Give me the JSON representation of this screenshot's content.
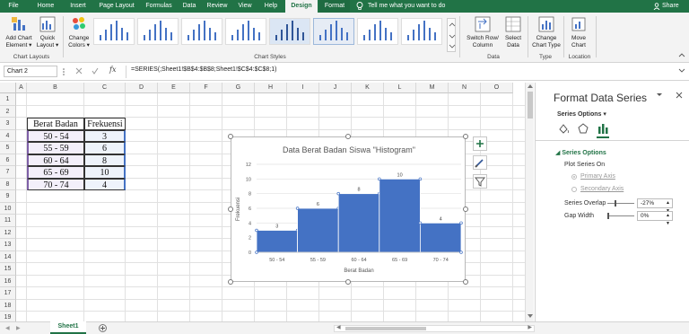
{
  "tabs": [
    "File",
    "Home",
    "Insert",
    "Page Layout",
    "Formulas",
    "Data",
    "Review",
    "View",
    "Help",
    "Design",
    "Format"
  ],
  "tell_me": "Tell me what you want to do",
  "share": "Share",
  "ribbon": {
    "add_chart_element": [
      "Add Chart",
      "Element ▾"
    ],
    "quick_layout": [
      "Quick",
      "Layout ▾"
    ],
    "change_colors": [
      "Change",
      "Colors ▾"
    ],
    "switch_row_column": [
      "Switch Row/",
      "Column"
    ],
    "select_data": [
      "Select",
      "Data"
    ],
    "change_chart_type": [
      "Change",
      "Chart Type"
    ],
    "move_chart": [
      "Move",
      "Chart"
    ],
    "groups": {
      "chart_layouts": "Chart Layouts",
      "chart_styles": "Chart Styles",
      "data": "Data",
      "type": "Type",
      "location": "Location"
    }
  },
  "formula_bar": {
    "name_box": "Chart 2",
    "fx": "fx",
    "formula": "=SERIES(;Sheet1!$B$4:$B$8;Sheet1!$C$4:$C$8;1)"
  },
  "columns": [
    "A",
    "B",
    "C",
    "D",
    "E",
    "F",
    "G",
    "H",
    "I",
    "J",
    "K",
    "L",
    "M",
    "N",
    "O"
  ],
  "rows": [
    "1",
    "2",
    "3",
    "4",
    "5",
    "6",
    "7",
    "8",
    "9",
    "10",
    "11",
    "12",
    "13",
    "14",
    "15",
    "16",
    "17",
    "18",
    "19"
  ],
  "table": {
    "header": [
      "Berat Badan",
      "Frekuensi"
    ],
    "rows": [
      [
        "50 - 54",
        "3"
      ],
      [
        "55 - 59",
        "6"
      ],
      [
        "60 - 64",
        "8"
      ],
      [
        "65 - 69",
        "10"
      ],
      [
        "70 - 74",
        "4"
      ]
    ]
  },
  "chart_data": {
    "type": "bar",
    "title": "Data Berat Badan Siswa \"Histogram\"",
    "xlabel": "Berat Badan",
    "ylabel": "Frekuensi",
    "categories": [
      "50 - 54",
      "55 - 59",
      "60 - 64",
      "65 - 69",
      "70 - 74"
    ],
    "values": [
      3,
      6,
      8,
      10,
      4
    ],
    "ylim": [
      0,
      12
    ],
    "yticks": [
      "0",
      "2",
      "4",
      "6",
      "8",
      "10",
      "12"
    ],
    "gap_width_pct": 0,
    "bar_color": "#4472c4",
    "grid": true
  },
  "panel": {
    "title": "Format Data Series",
    "series_options_menu": "Series Options",
    "section": "Series Options",
    "plot_series_on": "Plot Series On",
    "primary_axis": "Primary Axis",
    "secondary_axis": "Secondary Axis",
    "series_overlap_label": "Series Overlap",
    "series_overlap_value": "-27%",
    "gap_width_label": "Gap Width",
    "gap_width_value": "0%"
  },
  "sheet": {
    "tab": "Sheet1"
  },
  "colors": {
    "excel_green": "#217346",
    "bar": "#4472c4",
    "selection_purple": "#7f60a8"
  }
}
